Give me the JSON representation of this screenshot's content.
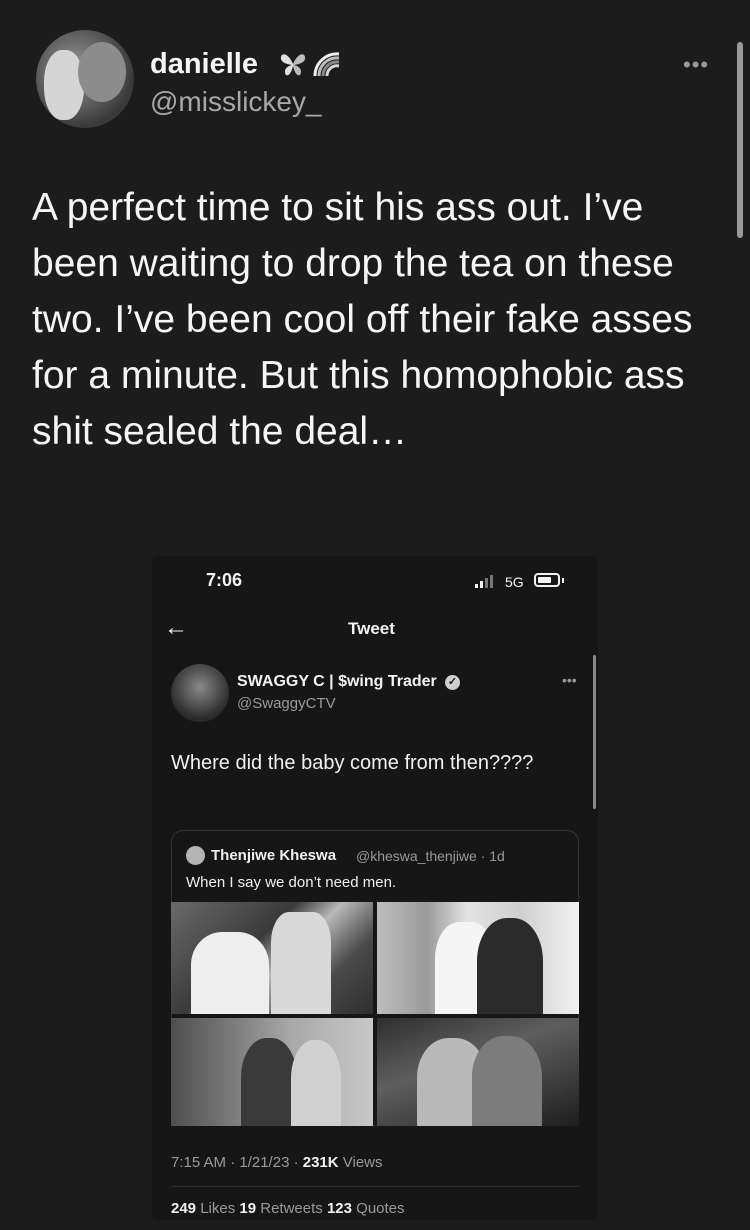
{
  "author": {
    "display_name": "danielle",
    "handle": "@misslickey_",
    "badges": [
      "butterfly-icon",
      "rainbow-icon"
    ]
  },
  "tweet": {
    "text": "A perfect time to sit his ass out. I’ve been waiting to drop the tea on these two. I’ve been cool off their fake asses for a minute. But this homophobic ass shit sealed the deal…"
  },
  "screenshot": {
    "status_time": "7:06",
    "network": "5G",
    "page_title": "Tweet",
    "author": {
      "display_name": "SWAGGY C | $wing Trader",
      "handle": "@SwaggyCTV"
    },
    "text": "Where did the baby come from then????",
    "quote": {
      "author_name": "Thenjiwe Kheswa",
      "author_handle_time": "@kheswa_thenjiwe · 1d",
      "text": "When I say we don’t need men."
    },
    "meta": {
      "time_date": "7:15 AM · 1/21/23 · ",
      "views_count": "231K",
      "views_label": " Views"
    },
    "stats": {
      "likes_count": "249",
      "likes_label": " Likes ",
      "retweets_count": "19",
      "retweets_label": " Retweets ",
      "quotes_count": "123",
      "quotes_label": " Quotes"
    }
  }
}
